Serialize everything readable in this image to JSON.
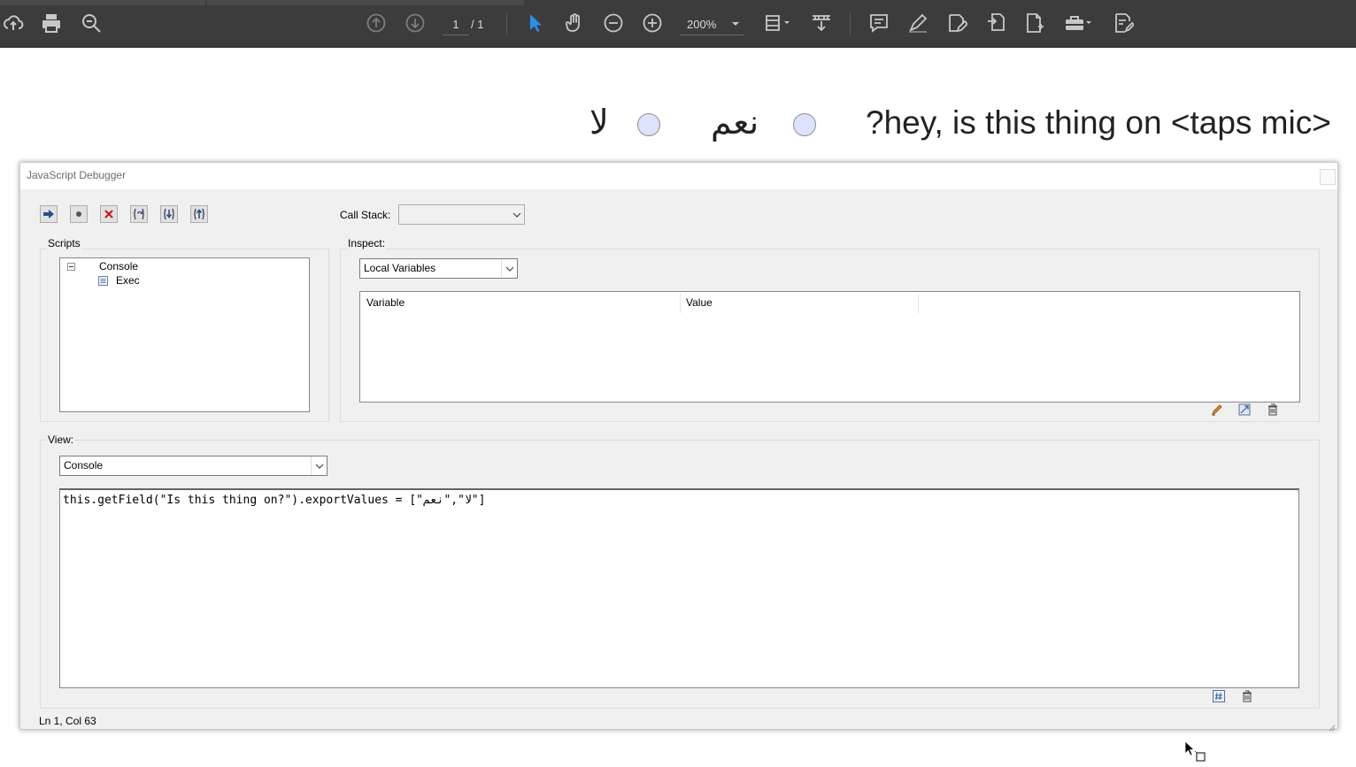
{
  "toolbar": {
    "icons": [
      "cloud-upload-icon",
      "print-icon",
      "zoom-search-icon",
      "prev-page-icon",
      "next-page-icon",
      "select-arrow-icon",
      "hand-icon",
      "zoom-out-icon",
      "zoom-in-icon",
      "fit-page-icon",
      "scroll-mode-icon",
      "comment-icon",
      "highlight-pen-icon",
      "edit-pdf-icon",
      "export-pdf-icon",
      "create-pdf-icon",
      "tools-icon",
      "fill-sign-icon"
    ],
    "page_current": "1",
    "page_total": "/ 1",
    "zoom": "200%",
    "colors": {
      "background": "#3c3c3c",
      "icon": "#c8c8c8",
      "accent": "#2d8ceb"
    }
  },
  "pdf": {
    "question": "?hey, is this thing on <taps mic>",
    "option_yes": "نعم",
    "option_no": "لا"
  },
  "debugger": {
    "title": "JavaScript Debugger",
    "buttons": [
      "resume-icon",
      "pause-icon",
      "stop-icon",
      "step-over-icon",
      "step-into-icon",
      "step-out-icon"
    ],
    "call_stack_label": "Call Stack:",
    "call_stack_value": "",
    "scripts_label": "Scripts",
    "tree": {
      "root": "Console",
      "child": "Exec"
    },
    "inspect_label": "Inspect:",
    "inspect_select": "Local Variables",
    "columns": [
      "Variable",
      "Value"
    ],
    "view_label": "View:",
    "view_select": "Console",
    "console_text": "this.getField(\"Is this thing on?\").exportValues = [\"لا\",\"نعم\"]",
    "status": "Ln 1, Col 63"
  }
}
